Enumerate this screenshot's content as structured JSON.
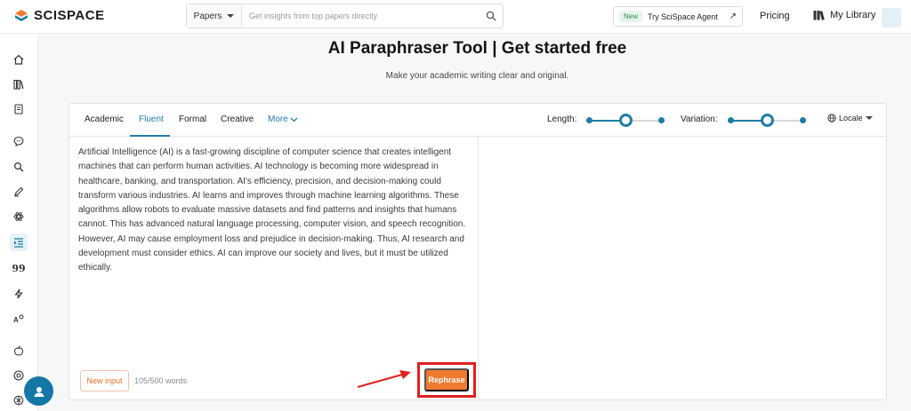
{
  "brand": {
    "name": "SCISPACE"
  },
  "search": {
    "filter": "Papers",
    "placeholder": "Get insights from top papers directly"
  },
  "topnav": {
    "new_badge": "New",
    "agent_label": "Try SciSpace Agent",
    "agent_arrow": "↗",
    "pricing": "Pricing",
    "library": "My Library"
  },
  "page": {
    "title": "AI Paraphraser Tool | Get started free",
    "subtitle": "Make your academic writing clear and original."
  },
  "modes": [
    "Academic",
    "Fluent",
    "Formal",
    "Creative",
    "More"
  ],
  "active_mode": "Fluent",
  "controls": {
    "length_label": "Length:",
    "length_level": 0.5,
    "variation_label": "Variation:",
    "variation_level": 0.5,
    "locale_label": "Locale"
  },
  "editor": {
    "input_text": "Artificial Intelligence (AI) is a fast-growing discipline of computer science that creates intelligent machines that can perform human activities. AI technology is becoming more widespread in healthcare, banking, and transportation. AI's efficiency, precision, and decision-making could transform various industries. AI learns and improves through machine learning algorithms. These algorithms allow robots to evaluate massive datasets and find patterns and insights that humans cannot. This has advanced natural language processing, computer vision, and speech recognition. However, AI may cause employment loss and prejudice in decision-making. Thus, AI research and development must consider ethics. AI can improve our society and lives, but it must be utilized ethically.",
    "new_input_label": "New input",
    "word_count": "105/500 words",
    "rephrase_label": "Rephrase"
  },
  "colors": {
    "accent": "#1f7da6",
    "cta": "#f07a30",
    "highlight": "#e02020"
  }
}
